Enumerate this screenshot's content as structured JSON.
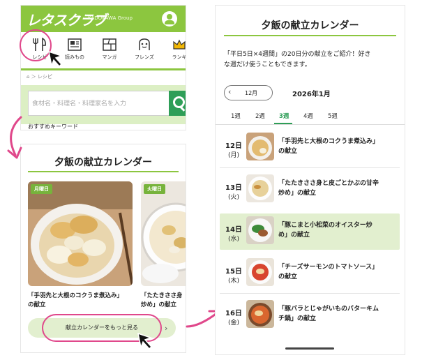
{
  "top_screen": {
    "logo": "レタスクラブ",
    "publisher": "KADOKAWA Group",
    "categories": [
      {
        "label": "レシピ",
        "icon": "fork-knife-icon"
      },
      {
        "label": "読みもの",
        "icon": "newspaper-icon"
      },
      {
        "label": "マンガ",
        "icon": "manga-icon"
      },
      {
        "label": "フレンズ",
        "icon": "friends-icon"
      },
      {
        "label": "ランキ",
        "icon": "crown-icon"
      }
    ],
    "breadcrumb": "レシピ",
    "search_placeholder": "食材名・料理名・料理家名を入力",
    "keywords_heading": "おすすめキーワード"
  },
  "calendar_card": {
    "title": "夕飯の献立カレンダー",
    "items": [
      {
        "badge": "月曜日",
        "caption_l1": "「手羽先と大根のコクうま煮込み」",
        "caption_l2": "の献立"
      },
      {
        "badge": "火曜日",
        "caption_l1": "「たたきささ身",
        "caption_l2": "炒め」の献立"
      }
    ],
    "more_button": "献立カレンダーをもっと見る"
  },
  "detail_screen": {
    "title": "夕飯の献立カレンダー",
    "intro_l1": "「平日5日×4週間」の20日分の献立をご紹介！好き",
    "intro_l2": "な週だけ使うこともできます。",
    "prev_month": "12月",
    "current_month": "2026年1月",
    "weeks": [
      "1週",
      "2週",
      "3週",
      "4週",
      "5週"
    ],
    "active_week": "3週",
    "days": [
      {
        "day": "12日",
        "weekday": "(月)",
        "line1": "「手羽先と大根のコクうま煮込み」",
        "line2": "の献立"
      },
      {
        "day": "13日",
        "weekday": "(火)",
        "line1": "「たたきささ身と皮ごとかぶの甘辛",
        "line2": "炒め」の献立"
      },
      {
        "day": "14日",
        "weekday": "(水)",
        "line1": "「豚こまと小松菜のオイスター炒",
        "line2": "め」の献立"
      },
      {
        "day": "15日",
        "weekday": "(木)",
        "line1": "「チーズサーモンのトマトソース」",
        "line2": "の献立"
      },
      {
        "day": "16日",
        "weekday": "(金)",
        "line1": "「豚バラとじゃがいものバターキム",
        "line2": "チ鍋」の献立"
      }
    ]
  },
  "colors": {
    "brand": "#8cc63f",
    "accent": "#2e9e57",
    "highlight": "#e2efcf",
    "annotation": "#e0488b"
  }
}
